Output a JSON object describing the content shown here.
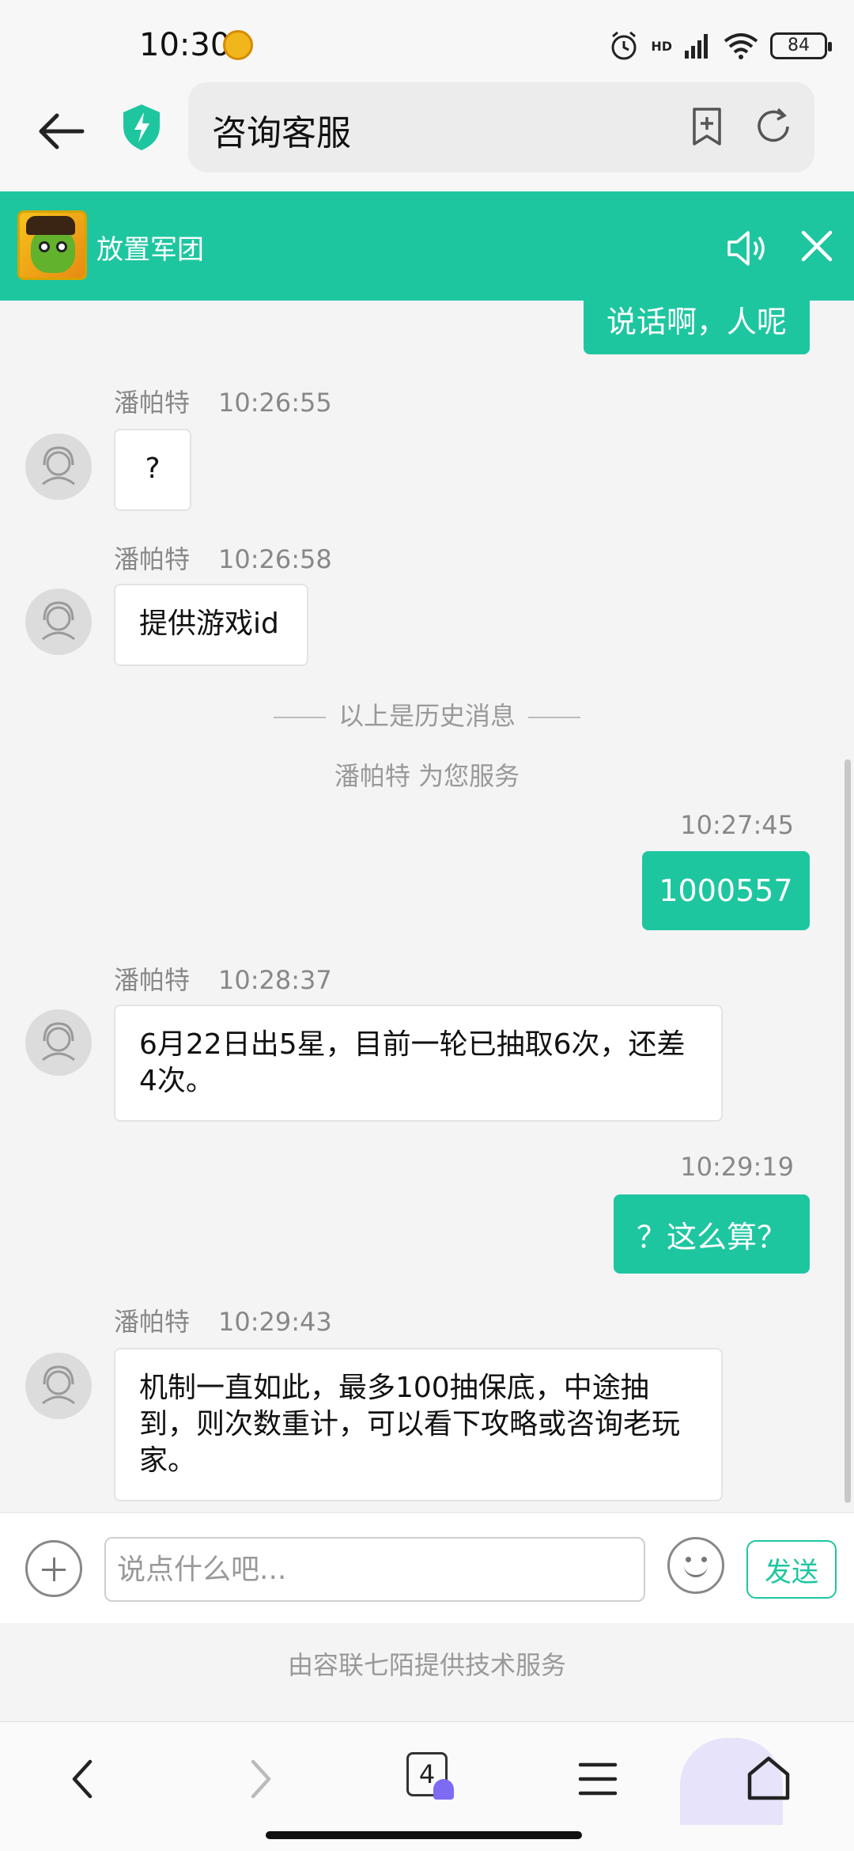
{
  "status_bar": {
    "time": "10:30",
    "signal_label": "HD",
    "battery": "84"
  },
  "browser": {
    "url_title": "咨询客服"
  },
  "app_banner": {
    "name": "放置军团"
  },
  "chat": {
    "earlier_user_message": "说话啊，人呢",
    "messages": [
      {
        "sender": "潘帕特",
        "time": "10:26:55",
        "text": "?"
      },
      {
        "sender": "潘帕特",
        "time": "10:26:58",
        "text": "提供游戏id"
      },
      {
        "sender": "潘帕特",
        "time": "10:28:37",
        "text": "6月22日出5星，目前一轮已抽取6次，还差4次。"
      },
      {
        "sender": "潘帕特",
        "time": "10:29:43",
        "text": "机制一直如此，最多100抽保底，中途抽到，则次数重计，可以看下攻略或咨询老玩家。"
      }
    ],
    "history_divider": "以上是历史消息",
    "service_note": "潘帕特 为您服务",
    "user_messages": [
      {
        "time": "10:27:45",
        "text": "1000557"
      },
      {
        "time": "10:29:19",
        "text": "？这么算？"
      }
    ]
  },
  "input": {
    "placeholder": "说点什么吧...",
    "send_label": "发送"
  },
  "footer": {
    "powered_by": "由容联七陌提供技术服务"
  },
  "bottom_nav": {
    "tab_count": "4"
  },
  "colors": {
    "accent": "#1ec6a0",
    "bubble_left_bg": "#ffffff",
    "page_bg": "#f4f4f4"
  },
  "icons": [
    "back-arrow-icon",
    "shield-bolt-icon",
    "bookmark-add-icon",
    "refresh-icon",
    "speaker-icon",
    "close-icon",
    "plus-icon",
    "emoji-icon",
    "nav-back-icon",
    "nav-forward-icon",
    "menu-icon",
    "home-icon"
  ]
}
